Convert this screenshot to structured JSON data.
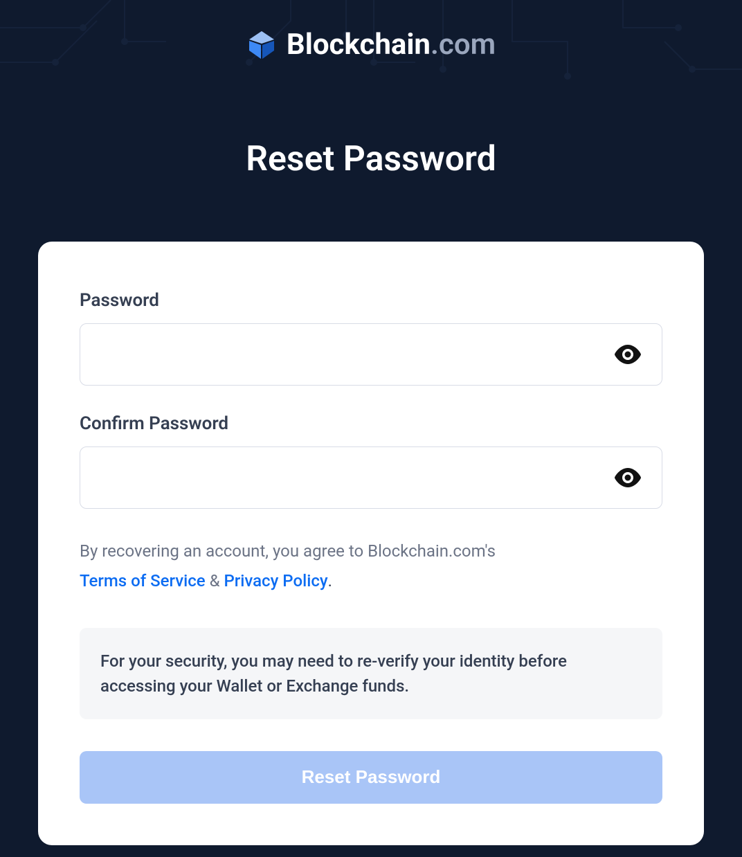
{
  "brand": {
    "name_primary": "Blockchain",
    "name_suffix": ".com"
  },
  "page": {
    "title": "Reset Password"
  },
  "form": {
    "password_label": "Password",
    "password_value": "",
    "confirm_label": "Confirm Password",
    "confirm_value": ""
  },
  "consent": {
    "prefix": "By recovering an account, you agree to Blockchain.com's",
    "terms_label": "Terms of Service",
    "amp": "&",
    "privacy_label": "Privacy Policy",
    "period": "."
  },
  "notice": {
    "text": "For your security, you may need to re-verify your identity before accessing your Wallet or Exchange funds."
  },
  "actions": {
    "submit_label": "Reset Password"
  }
}
